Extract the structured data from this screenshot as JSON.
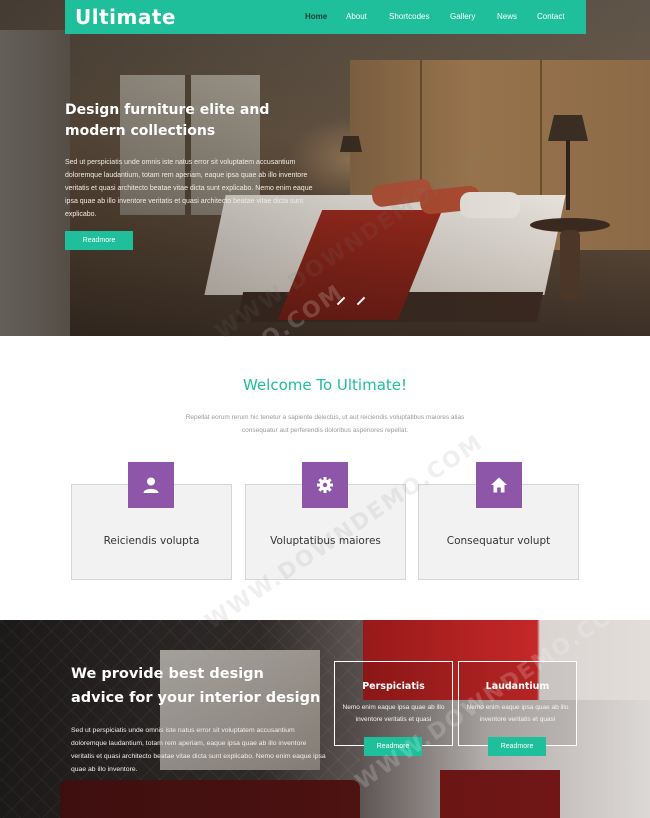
{
  "nav": {
    "logo": "Ultimate",
    "items": [
      "Home",
      "About",
      "Shortcodes",
      "Gallery",
      "News",
      "Contact"
    ],
    "active": "Home"
  },
  "hero": {
    "title": "Design furniture elite and modern collections",
    "text": "Sed ut perspiciatis unde omnis iste natus error sit voluptatem accusantium doloremque laudantium, totam rem aperiam, eaque ipsa quae ab illo inventore veritatis et quasi architecto beatae vitae dicta sunt explicabo. Nemo enim eaque ipsa quae ab illo inventore veritatis et quasi architecto beatae vitae dicta sunt explicabo.",
    "button": "Readmore"
  },
  "welcome": {
    "title": "Welcome To Ultimate!",
    "text": "Repellat eorum rerum hic tenetur a sapiente delectus, ut aut reiciendis voluptatibus maiores alias consequatur aut perferendis doloribus asperiores repellat."
  },
  "cards": [
    {
      "label": "Reiciendis volupta",
      "icon": "user-icon"
    },
    {
      "label": "Voluptatibus maiores",
      "icon": "gear-icon"
    },
    {
      "label": "Consequatur volupt",
      "icon": "home-icon"
    }
  ],
  "advice": {
    "title": "We provide best design advice for your interior design",
    "text": "Sed ut perspiciatis unde omnis iste natus error sit voluptatem accusantium doloremque laudantium, totam rem aperiam, eaque ipsa quae ab illo inventore veritatis et quasi architecto beatae vitae dicta sunt explicabo. Nemo enim eaque ipsa quae ab illo inventore."
  },
  "features": [
    {
      "title": "Perspiciatis",
      "text": "Nemo enim eaque ipsa quae ab illo inventore veritatis et quasi",
      "button": "Readmore"
    },
    {
      "title": "Laudantium",
      "text": "Nemo enim eaque ipsa quae ab illo inventore veritatis et quasi",
      "button": "Readmore"
    }
  ],
  "watermark": "WWW.DOWNDEMO.COM",
  "colors": {
    "accent": "#1fbf9c",
    "icon_bg": "#8e56a8"
  }
}
